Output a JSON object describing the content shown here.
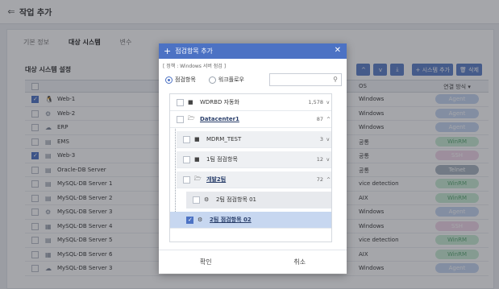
{
  "header": {
    "title": "작업 추가"
  },
  "tabs": [
    {
      "label": "기본 정보",
      "active": false
    },
    {
      "label": "대상 시스템",
      "active": true
    },
    {
      "label": "변수",
      "active": false
    }
  ],
  "section_title": "대상 시스템 설정",
  "toolbar": {
    "btn1": "^",
    "btn2": "v",
    "btn3": "⤓",
    "add_system": "+ 시스템 추가",
    "delete": "🗑 삭제"
  },
  "table": {
    "headers": {
      "os": "OS",
      "conn": "연결 방식 ▾"
    },
    "rows": [
      {
        "name": "Web-1",
        "os": "Windows",
        "conn": "Agent",
        "checked": true,
        "icon": "penguin-icon"
      },
      {
        "name": "Web-2",
        "os": "Windows",
        "conn": "Agent",
        "checked": false,
        "icon": "gear-icon"
      },
      {
        "name": "ERP",
        "os": "Windows",
        "conn": "Agent",
        "checked": false,
        "icon": "cloud-icon"
      },
      {
        "name": "EMS",
        "os": "공통",
        "conn": "WinRM",
        "checked": false,
        "icon": "server-icon"
      },
      {
        "name": "Web-3",
        "os": "공통",
        "conn": "SSH",
        "checked": true,
        "icon": "server-icon"
      },
      {
        "name": "Oracle-DB Server",
        "os": "공통",
        "conn": "Telnet",
        "checked": false,
        "icon": "server-icon"
      },
      {
        "name": "MySQL-DB Server 1",
        "os": "vice detection",
        "conn": "WinRM",
        "checked": false,
        "icon": "server-icon"
      },
      {
        "name": "MySQL-DB Server 2",
        "os": "AIX",
        "conn": "WinRM",
        "checked": false,
        "icon": "server-icon"
      },
      {
        "name": "MySQL-DB Server 3",
        "os": "Windows",
        "conn": "Agent",
        "checked": false,
        "icon": "gear-icon"
      },
      {
        "name": "MySQL-DB Server 4",
        "os": "Windows",
        "conn": "SSH",
        "checked": false,
        "icon": "database-icon"
      },
      {
        "name": "MySQL-DB Server 5",
        "os": "vice detection",
        "conn": "WinRM",
        "checked": false,
        "icon": "server-icon"
      },
      {
        "name": "MySQL-DB Server 6",
        "os": "AIX",
        "conn": "WinRM",
        "checked": false,
        "icon": "database-icon"
      },
      {
        "name": "MySQL-DB Server 3",
        "os": "Windows",
        "conn": "Agent",
        "checked": false,
        "icon": "cloud-icon"
      }
    ]
  },
  "modal": {
    "title": "점검항목 추가",
    "subtitle": "[ 정책 : Windows 서버 점검 ]",
    "radio_1": "점검항목",
    "radio_2": "워크플로우",
    "search_placeholder": "",
    "tree": [
      {
        "label": "WDRBD 자동화",
        "count": "1,578",
        "chev": "v",
        "icon": "folder-icon"
      },
      {
        "label": "Datacenter1",
        "count": "87",
        "chev": "^",
        "icon": "folder-open-icon"
      },
      {
        "label": "MDRM_TEST",
        "count": "3",
        "chev": "v",
        "icon": "folder-icon"
      },
      {
        "label": "1팀 점검항목",
        "count": "12",
        "chev": "v",
        "icon": "folder-icon"
      },
      {
        "label": "개발2팀",
        "count": "72",
        "chev": "^",
        "icon": "folder-open-icon"
      },
      {
        "label": "2팀 점검항목 01",
        "count": "",
        "chev": "",
        "icon": "gear-icon"
      },
      {
        "label": "2팀 점검항목 02",
        "count": "",
        "chev": "",
        "icon": "gear-icon"
      }
    ],
    "confirm": "확인",
    "cancel": "취소"
  }
}
